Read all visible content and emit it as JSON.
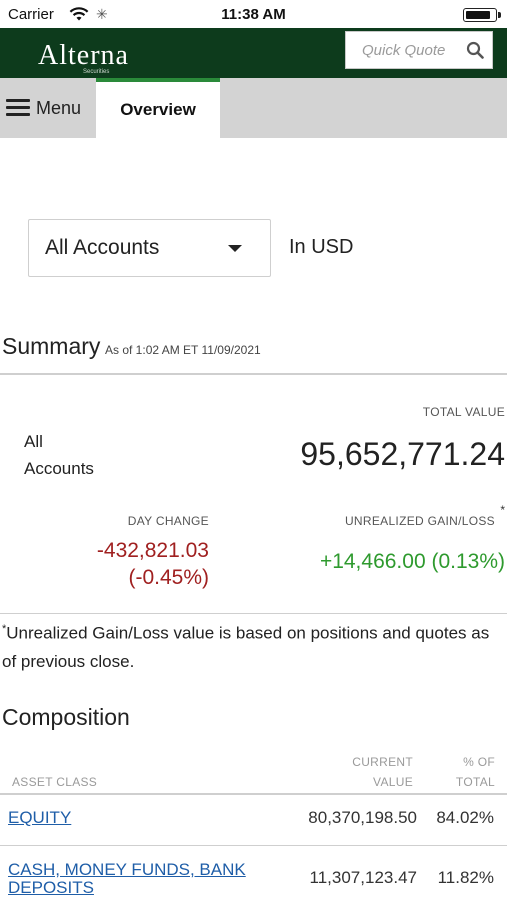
{
  "status_bar": {
    "carrier": "Carrier",
    "time": "11:38 AM",
    "battery_level": 0.85
  },
  "header": {
    "logo_text": "Alterna",
    "logo_subtext": "Securities",
    "quick_quote_placeholder": "Quick Quote",
    "brand_color": "#0d3b1c",
    "accent_color": "#2a8a3a"
  },
  "nav": {
    "menu_label": "Menu",
    "tabs": [
      {
        "label": "Overview",
        "active": true
      }
    ]
  },
  "account_selector": {
    "selected": "All Accounts",
    "currency_label": "In USD"
  },
  "summary": {
    "title": "Summary",
    "as_of": "As of 1:02 AM ET 11/09/2021",
    "total_value_label": "TOTAL VALUE",
    "account_label_line1": "All",
    "account_label_line2": "Accounts",
    "total_value": "95,652,771.24",
    "day_change_label": "DAY CHANGE",
    "day_change_value": "-432,821.03",
    "day_change_pct": "(-0.45%)",
    "unrealized_label": "UNREALIZED GAIN/LOSS",
    "unrealized_marker": "*",
    "unrealized_value": "+14,466.00 (0.13%)",
    "negative_color": "#a02020",
    "positive_color": "#2e9a2e",
    "footnote_marker": "*",
    "footnote": "Unrealized Gain/Loss value is based on positions and quotes as of previous close."
  },
  "composition": {
    "title": "Composition",
    "headers": {
      "asset_class": "ASSET CLASS",
      "current_value_line1": "CURRENT",
      "current_value_line2": "VALUE",
      "pct_line1": "% OF",
      "pct_line2": "TOTAL"
    },
    "rows": [
      {
        "asset_class": "EQUITY",
        "value": "80,370,198.50",
        "pct": "84.02%"
      },
      {
        "asset_class_line1": "CASH, MONEY FUNDS, BANK",
        "asset_class_line2": "DEPOSITS",
        "value": "11,307,123.47",
        "pct": "11.82%"
      }
    ]
  }
}
